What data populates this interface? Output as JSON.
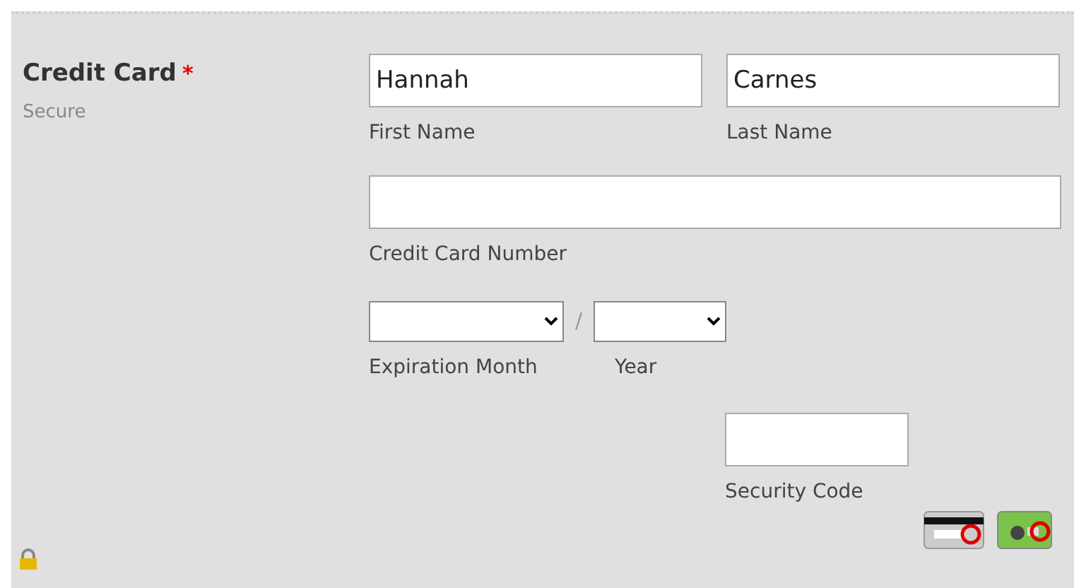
{
  "section": {
    "label": "Credit Card",
    "required_mark": "*",
    "sublabel": "Secure"
  },
  "name_fields": [
    {
      "value": "Hannah",
      "label": "First Name"
    },
    {
      "value": "Carnes",
      "label": "Last Name"
    }
  ],
  "card_number": {
    "label": "Credit Card Number"
  },
  "expiration": {
    "month_label": "Expiration Month",
    "separator": "/",
    "year_label": "Year"
  },
  "security_code": {
    "label": "Security Code"
  }
}
